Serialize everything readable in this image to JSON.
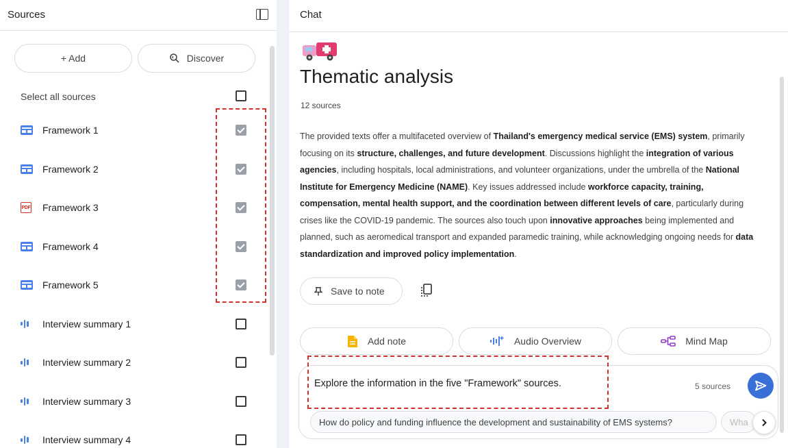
{
  "colors": {
    "accent_blue": "#3b6fd8",
    "web_icon_blue": "#4a80e8",
    "pdf_red": "#d93025",
    "checked_gray": "#9aa0a6",
    "highlight_red": "#d32f2f",
    "note_yellow": "#f6b400",
    "mindmap_purple": "#8e3fc8"
  },
  "sources_panel": {
    "title": "Sources",
    "toggle_icon": "side-panel-icon",
    "add_button": {
      "icon": "plus-icon",
      "label": "+ Add"
    },
    "discover_button": {
      "icon": "discover-search-icon",
      "label": "Discover"
    },
    "select_all": {
      "label": "Select all sources",
      "checked": false
    },
    "items": [
      {
        "label": "Framework 1",
        "icon": "web-icon",
        "checked": true
      },
      {
        "label": "Framework 2",
        "icon": "web-icon",
        "checked": true
      },
      {
        "label": "Framework 3",
        "icon": "pdf-icon",
        "icon_text": "PDF",
        "checked": true
      },
      {
        "label": "Framework 4",
        "icon": "web-icon",
        "checked": true
      },
      {
        "label": "Framework 5",
        "icon": "web-icon",
        "checked": true
      },
      {
        "label": "Interview summary 1",
        "icon": "audio-icon",
        "checked": false
      },
      {
        "label": "Interview summary 2",
        "icon": "audio-icon",
        "checked": false
      },
      {
        "label": "Interview summary 3",
        "icon": "audio-icon",
        "checked": false
      },
      {
        "label": "Interview summary 4",
        "icon": "audio-icon",
        "checked": false
      }
    ]
  },
  "chat_panel": {
    "title": "Chat",
    "notebook_icon": "ambulance-emoji-icon",
    "notebook_title": "Thematic analysis",
    "source_count": "12 sources",
    "summary_segments": [
      {
        "text": "The provided texts offer a multifaceted overview of ",
        "bold": false
      },
      {
        "text": "Thailand's emergency medical service (EMS) system",
        "bold": true
      },
      {
        "text": ", primarily focusing on its ",
        "bold": false
      },
      {
        "text": "structure, challenges, and future development",
        "bold": true
      },
      {
        "text": ". Discussions highlight the ",
        "bold": false
      },
      {
        "text": "integration of various agencies",
        "bold": true
      },
      {
        "text": ", including hospitals, local administrations, and volunteer organizations, under the umbrella of the ",
        "bold": false
      },
      {
        "text": "National Institute for Emergency Medicine (NAME)",
        "bold": true
      },
      {
        "text": ". Key issues addressed include ",
        "bold": false
      },
      {
        "text": "workforce capacity, training, compensation, mental health support, and the coordination between different levels of care",
        "bold": true
      },
      {
        "text": ", particularly during crises like the COVID-19 pandemic. The sources also touch upon ",
        "bold": false
      },
      {
        "text": "innovative approaches",
        "bold": true
      },
      {
        "text": " being implemented and planned, such as aeromedical transport and expanded paramedic training, while acknowledging ongoing needs for ",
        "bold": false
      },
      {
        "text": "data standardization and improved policy implementation",
        "bold": true
      },
      {
        "text": ".",
        "bold": false
      }
    ],
    "save_to_note": {
      "icon": "pin-icon",
      "label": "Save to note"
    },
    "copy_icon": "copy-icon",
    "actions": [
      {
        "name": "add-note-button",
        "icon": "note-icon",
        "label": "Add note"
      },
      {
        "name": "audio-overview-button",
        "icon": "audio-overview-icon",
        "label": "Audio Overview"
      },
      {
        "name": "mind-map-button",
        "icon": "mind-map-icon",
        "label": "Mind Map"
      }
    ],
    "composer": {
      "input_value": "Explore the information in the five \"Framework\" sources.",
      "source_count": "5 sources",
      "send_icon": "send-icon",
      "suggestions": [
        "How do policy and funding influence the development and sustainability of EMS systems?",
        "Wha"
      ],
      "next_icon": "chevron-right-icon"
    }
  }
}
